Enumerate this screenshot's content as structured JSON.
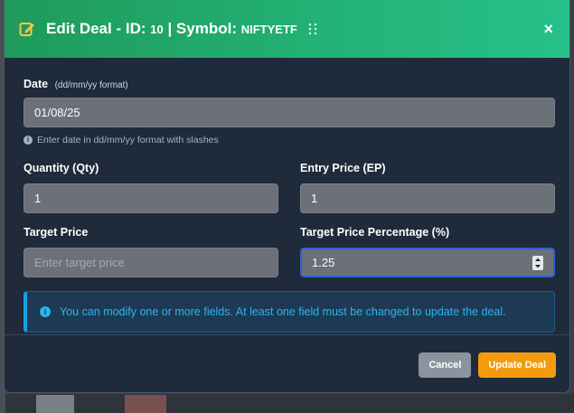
{
  "header": {
    "title_prefix": "Edit Deal - ID:",
    "deal_id": "10",
    "title_symbol_label": "| Symbol:",
    "symbol": "NIFTYETF",
    "close_glyph": "×",
    "edit_icon": "edit-icon",
    "drag_icon": "drag-handle-icon"
  },
  "form": {
    "date": {
      "label": "Date",
      "hint": "(dd/mm/yy format)",
      "value": "01/08/25",
      "helper": "Enter date in dd/mm/yy format with slashes"
    },
    "quantity": {
      "label": "Quantity (Qty)",
      "value": "1"
    },
    "entry_price": {
      "label": "Entry Price (EP)",
      "value": "1"
    },
    "target_price": {
      "label": "Target Price",
      "value": "",
      "placeholder": "Enter target price"
    },
    "target_pct": {
      "label": "Target Price Percentage (%)",
      "value": "1.25"
    }
  },
  "alert": {
    "text": "You can modify one or more fields. At least one field must be changed to update the deal."
  },
  "footer": {
    "cancel_label": "Cancel",
    "update_label": "Update Deal"
  },
  "colors": {
    "header_green": "#23b377",
    "modal_bg": "#1f2a3a",
    "input_bg": "#6b7079",
    "alert_text": "#2ab3f0",
    "update_orange": "#f29b0f",
    "cancel_gray": "#8a949f",
    "focus_border": "#2f5fd0"
  }
}
